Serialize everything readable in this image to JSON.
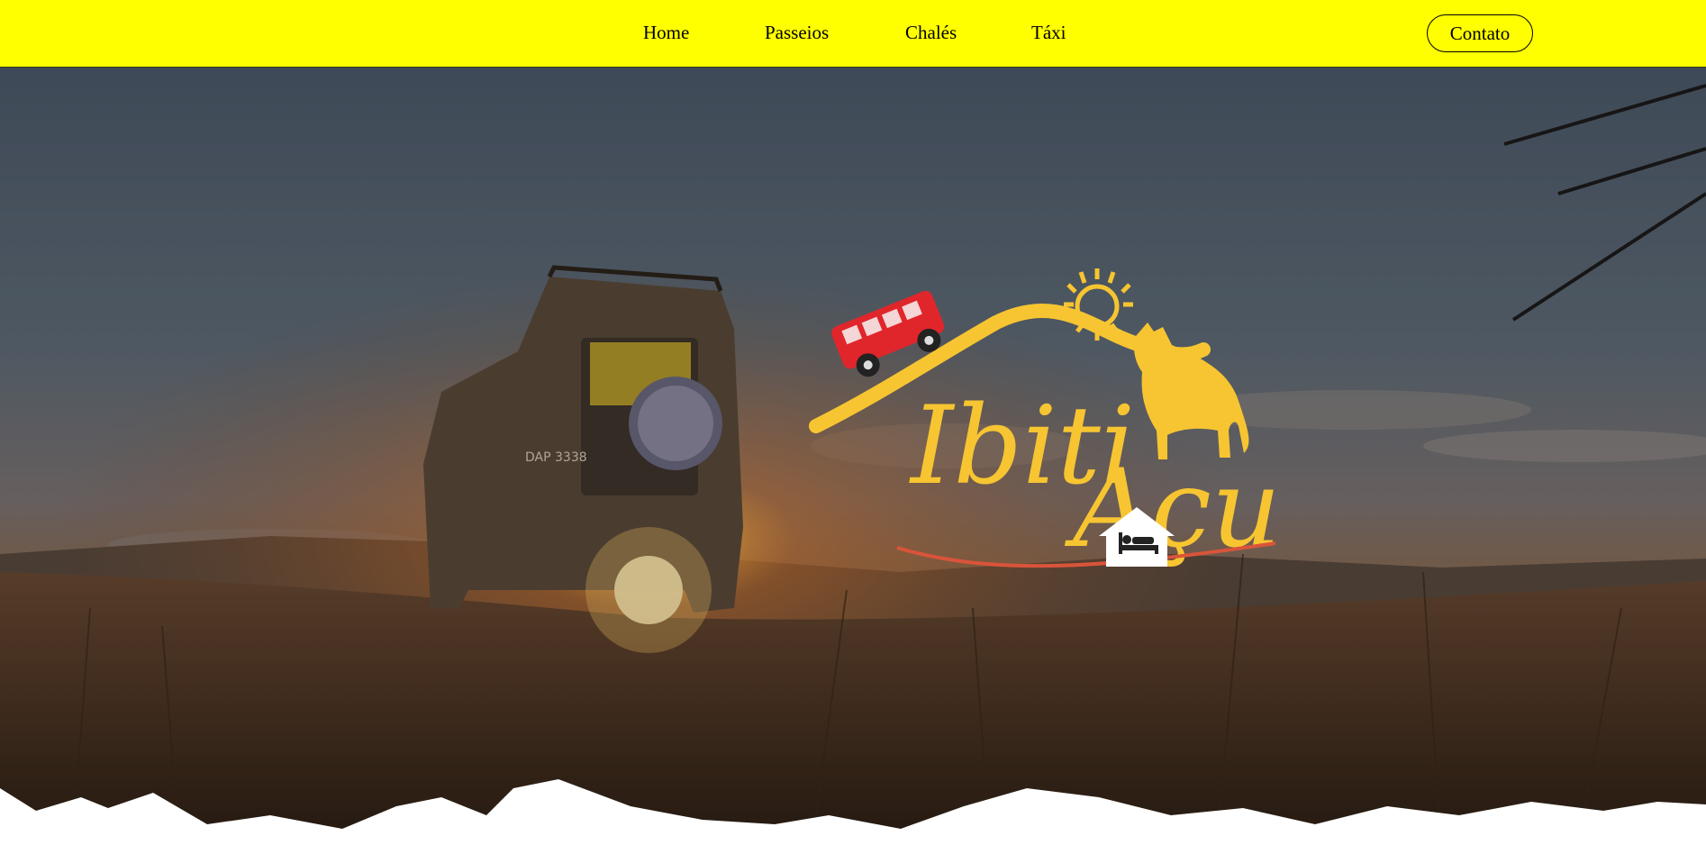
{
  "nav": {
    "items": [
      {
        "label": "Home"
      },
      {
        "label": "Passeios"
      },
      {
        "label": "Chalés"
      },
      {
        "label": "Táxi"
      }
    ],
    "contact_label": "Contato"
  },
  "hero": {
    "logo_line1": "Ibiti",
    "logo_line2": "Açu",
    "vehicle_plate": "DAP 3338",
    "icons": [
      "jeep-icon",
      "sun-icon",
      "horse-icon",
      "chalet-bed-icon"
    ]
  },
  "colors": {
    "topbar": "#ffff00",
    "logo_yellow": "#f7c531",
    "jeep_red": "#e0262b"
  }
}
